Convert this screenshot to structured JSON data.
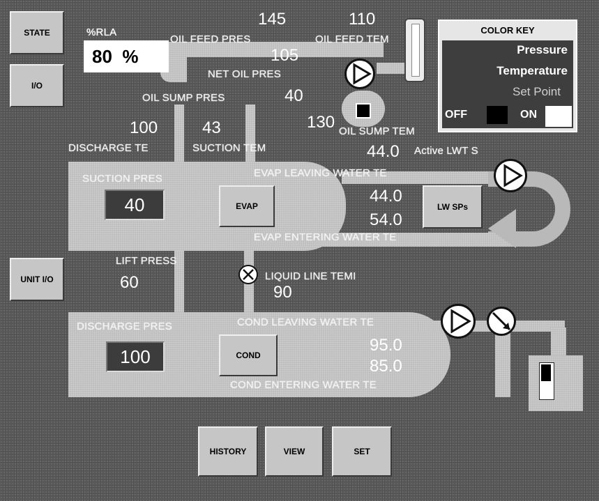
{
  "buttons": {
    "state": "STATE",
    "io": "I/O",
    "unit_io": "UNIT I/O",
    "evap": "EVAP",
    "cond": "COND",
    "lw_sps": "LW SPs",
    "history": "HISTORY",
    "view": "VIEW",
    "set": "SET"
  },
  "rla": {
    "label": "%RLA",
    "value": "80  %"
  },
  "oil": {
    "feed_pres_label": "OIL FEED PRES",
    "feed_pres_value": "145",
    "feed_temp_label": "OIL FEED TEM",
    "feed_temp_value": "110",
    "net_pres_label": "NET OIL PRES",
    "net_pres_value": "105",
    "sump_pres_label": "OIL SUMP PRES",
    "sump_pres_value": "40",
    "sump_temp_label": "OIL SUMP TEM",
    "sump_temp_value": "130"
  },
  "compressor": {
    "discharge_temp_label": "DISCHARGE TE",
    "discharge_temp_value": "100",
    "suction_temp_label": "SUCTION TEM",
    "suction_temp_value": "43"
  },
  "color_key": {
    "title": "COLOR KEY",
    "pressure": "Pressure",
    "temperature": "Temperature",
    "set_point": "Set Point",
    "off": "OFF",
    "on": "ON"
  },
  "evap": {
    "active_lwt_label": "Active LWT S",
    "active_lwt_value": "44.0",
    "leaving_label": "EVAP LEAVING WATER TE",
    "leaving_value": "44.0",
    "entering_label": "EVAP ENTERING WATER TE",
    "entering_value": "54.0",
    "suction_pres_label": "SUCTION PRES",
    "suction_pres_value": "40"
  },
  "lift": {
    "label": "LIFT PRESS",
    "value": "60"
  },
  "liquid_line": {
    "label": "LIQUID LINE TEMI",
    "value": "90"
  },
  "cond": {
    "leaving_label": "COND LEAVING WATER TE",
    "leaving_value": "95.0",
    "entering_label": "COND ENTERING WATER TE",
    "entering_value": "85.0",
    "discharge_pres_label": "DISCHARGE PRES",
    "discharge_pres_value": "100"
  },
  "colors": {
    "background": "#5d5d5d",
    "pipe": "#b9b9b9",
    "button": "#c6c6c6",
    "value_box": "#3c3c3c"
  }
}
